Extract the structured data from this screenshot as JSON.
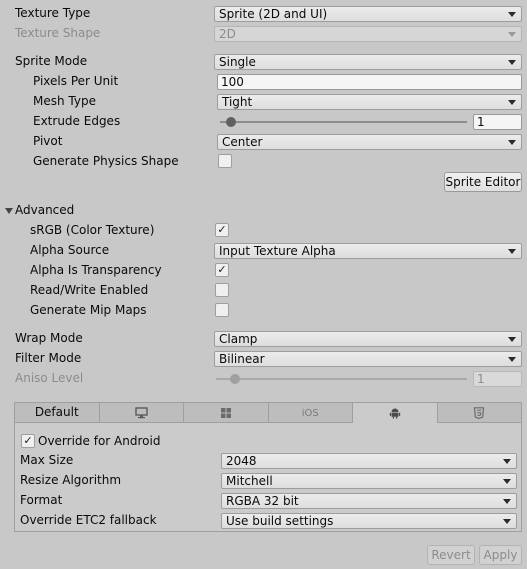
{
  "texture": {
    "texture_type": {
      "label": "Texture Type",
      "value": "Sprite (2D and UI)"
    },
    "texture_shape": {
      "label": "Texture Shape",
      "value": "2D"
    }
  },
  "sprite": {
    "sprite_mode": {
      "label": "Sprite Mode",
      "value": "Single"
    },
    "pixels_per_unit": {
      "label": "Pixels Per Unit",
      "value": "100"
    },
    "mesh_type": {
      "label": "Mesh Type",
      "value": "Tight"
    },
    "extrude_edges": {
      "label": "Extrude Edges",
      "value": "1"
    },
    "pivot": {
      "label": "Pivot",
      "value": "Center"
    },
    "generate_physics_shape": {
      "label": "Generate Physics Shape",
      "checked": ""
    },
    "sprite_editor_label": "Sprite Editor"
  },
  "advanced": {
    "title": "Advanced",
    "srgb": {
      "label": "sRGB (Color Texture)",
      "checked": "✓"
    },
    "alpha_source": {
      "label": "Alpha Source",
      "value": "Input Texture Alpha"
    },
    "alpha_is_transparency": {
      "label": "Alpha Is Transparency",
      "checked": "✓"
    },
    "read_write": {
      "label": "Read/Write Enabled",
      "checked": ""
    },
    "generate_mip_maps": {
      "label": "Generate Mip Maps",
      "checked": ""
    }
  },
  "wrap_filter": {
    "wrap_mode": {
      "label": "Wrap Mode",
      "value": "Clamp"
    },
    "filter_mode": {
      "label": "Filter Mode",
      "value": "Bilinear"
    },
    "aniso_level": {
      "label": "Aniso Level",
      "value": "1"
    }
  },
  "platform": {
    "tabs": [
      {
        "label": "Default",
        "icon": "text"
      },
      {
        "label": "",
        "icon": "monitor-icon"
      },
      {
        "label": "",
        "icon": "windows-icon"
      },
      {
        "label": "iOS",
        "icon": "text"
      },
      {
        "label": "",
        "icon": "android-icon"
      },
      {
        "label": "",
        "icon": "html5-icon"
      }
    ],
    "active_tab": 4,
    "override": {
      "label": "Override for Android",
      "checked": "✓"
    },
    "max_size": {
      "label": "Max Size",
      "value": "2048"
    },
    "resize_algorithm": {
      "label": "Resize Algorithm",
      "value": "Mitchell"
    },
    "format": {
      "label": "Format",
      "value": "RGBA 32 bit"
    },
    "override_etc2": {
      "label": "Override ETC2 fallback",
      "value": "Use build settings"
    }
  },
  "footer": {
    "revert_label": "Revert",
    "apply_label": "Apply"
  },
  "colors": {
    "background": "#c8c8c8",
    "field": "#e6e6e6"
  }
}
